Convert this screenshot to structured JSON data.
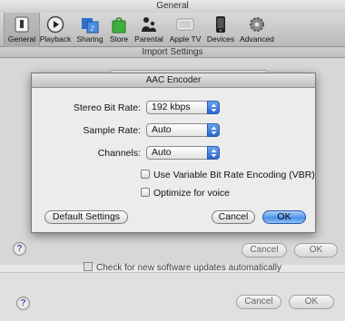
{
  "window": {
    "title": "General"
  },
  "toolbar": {
    "items": [
      {
        "label": "General",
        "icon": "general-switch-icon"
      },
      {
        "label": "Playback",
        "icon": "play-icon"
      },
      {
        "label": "Sharing",
        "icon": "sharing-icon"
      },
      {
        "label": "Store",
        "icon": "store-bag-icon"
      },
      {
        "label": "Parental",
        "icon": "parental-icon"
      },
      {
        "label": "Apple TV",
        "icon": "apple-tv-icon"
      },
      {
        "label": "Devices",
        "icon": "devices-icon"
      },
      {
        "label": "Advanced",
        "icon": "gear-icon"
      }
    ]
  },
  "import_sheet": {
    "title": "Import Settings",
    "cancel_label": "Cancel",
    "ok_label": "OK",
    "help_label": "?"
  },
  "main": {
    "check_updates_label": "Check for new software updates automatically",
    "cancel_label": "Cancel",
    "ok_label": "OK",
    "help_label": "?"
  },
  "aac": {
    "title": "AAC Encoder",
    "stereo_bit_rate_label": "Stereo Bit Rate:",
    "stereo_bit_rate_value": "192 kbps",
    "sample_rate_label": "Sample Rate:",
    "sample_rate_value": "Auto",
    "channels_label": "Channels:",
    "channels_value": "Auto",
    "vbr_label": "Use Variable Bit Rate Encoding (VBR)",
    "voice_label": "Optimize for voice",
    "default_settings_label": "Default Settings",
    "cancel_label": "Cancel",
    "ok_label": "OK"
  },
  "colors": {
    "accent": "#4a8ce6",
    "window_bg": "#e8e8e8"
  }
}
